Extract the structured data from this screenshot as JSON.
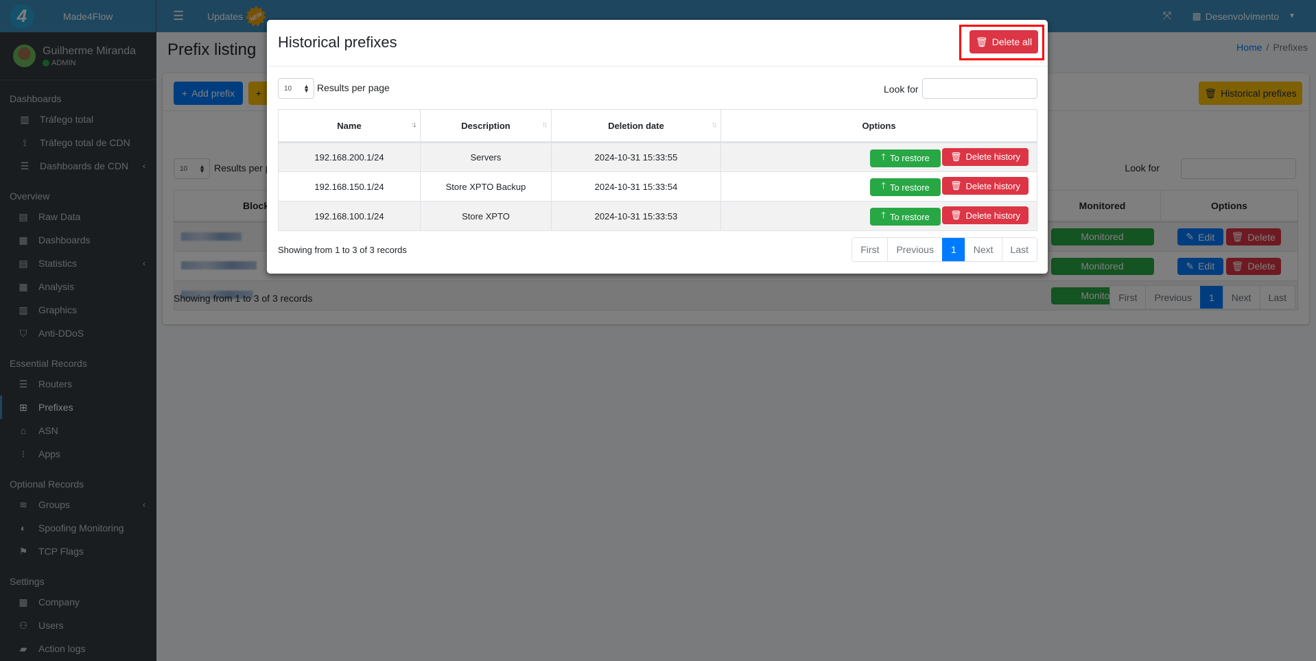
{
  "header": {
    "brand": "Made4Flow",
    "menu_icon": "hamburger-icon",
    "updates_label": "Updates",
    "new_badge": "NEW",
    "company": "Desenvolvimento"
  },
  "sidebar": {
    "user": {
      "name": "Guilherme Miranda",
      "role": "ADMIN",
      "status_color": "#28a745"
    },
    "sections": [
      {
        "title": "Dashboards",
        "items": [
          {
            "label": "Tráfego total",
            "icon": "chart-bar-icon"
          },
          {
            "label": "Tráfego total de CDN",
            "icon": "broadcast-tower-icon"
          },
          {
            "label": "Dashboards de CDN",
            "icon": "server-icon",
            "has_children": true
          }
        ]
      },
      {
        "title": "Overview",
        "items": [
          {
            "label": "Raw Data",
            "icon": "file-icon"
          },
          {
            "label": "Dashboards",
            "icon": "calendar-icon"
          },
          {
            "label": "Statistics",
            "icon": "poll-icon",
            "has_children": true
          },
          {
            "label": "Analysis",
            "icon": "grid-icon"
          },
          {
            "label": "Graphics",
            "icon": "chart-bar-icon"
          },
          {
            "label": "Anti-DDoS",
            "icon": "shield-icon"
          }
        ]
      },
      {
        "title": "Essential Records",
        "items": [
          {
            "label": "Routers",
            "icon": "server-icon"
          },
          {
            "label": "Prefixes",
            "icon": "sitemap-icon",
            "active": true
          },
          {
            "label": "ASN",
            "icon": "ethernet-icon"
          },
          {
            "label": "Apps",
            "icon": "traffic-light-icon"
          }
        ]
      },
      {
        "title": "Optional Records",
        "items": [
          {
            "label": "Groups",
            "icon": "layers-icon",
            "has_children": true
          },
          {
            "label": "Spoofing Monitoring",
            "icon": "mask-icon"
          },
          {
            "label": "TCP Flags",
            "icon": "flag-checkered-icon"
          }
        ]
      },
      {
        "title": "Settings",
        "items": [
          {
            "label": "Company",
            "icon": "building-icon"
          },
          {
            "label": "Users",
            "icon": "user-icon"
          },
          {
            "label": "Action logs",
            "icon": "folder-open-icon"
          }
        ]
      }
    ]
  },
  "page": {
    "title": "Prefix listing",
    "breadcrumb": {
      "home": "Home",
      "separator": "/",
      "current": "Prefixes"
    },
    "add_prefix_label": "Add prefix",
    "historical_prefixes_label": "Historical prefixes",
    "per_page_value": "10",
    "results_per_page_label": "Results per page",
    "look_for_label": "Look for",
    "table": {
      "headers": [
        "Block",
        "Monitored",
        "Options"
      ],
      "rows": [
        {
          "monitored": "Monitored"
        },
        {
          "monitored": "Monitored"
        },
        {
          "monitored": "Monitored"
        }
      ],
      "edit_label": "Edit",
      "delete_label": "Delete"
    },
    "showing": "Showing from 1 to 3 of 3 records",
    "pagination": [
      "First",
      "Previous",
      "1",
      "Next",
      "Last"
    ]
  },
  "modal": {
    "title": "Historical prefixes",
    "delete_all_label": "Delete all",
    "per_page_value": "10",
    "results_per_page_label": "Results per page",
    "look_for_label": "Look for",
    "search_value": "",
    "table": {
      "headers": [
        "Name",
        "Description",
        "Deletion date",
        "Options"
      ],
      "rows": [
        {
          "name": "192.168.200.1/24",
          "description": "Servers",
          "deletion_date": "2024-10-31 15:33:55"
        },
        {
          "name": "192.168.150.1/24",
          "description": "Store XPTO Backup",
          "deletion_date": "2024-10-31 15:33:54"
        },
        {
          "name": "192.168.100.1/24",
          "description": "Store XPTO",
          "deletion_date": "2024-10-31 15:33:53"
        }
      ],
      "restore_label": "To restore",
      "delete_history_label": "Delete history"
    },
    "showing": "Showing from 1 to 3 of 3 records",
    "pagination": [
      "First",
      "Previous",
      "1",
      "Next",
      "Last"
    ],
    "active_page": "1"
  },
  "colors": {
    "header_bg": "#3c8dbc",
    "sidebar_bg": "#343a40",
    "primary": "#007bff",
    "danger": "#dc3545",
    "success": "#28a745",
    "warning": "#ffc107",
    "highlight_border": "#ff0000"
  }
}
